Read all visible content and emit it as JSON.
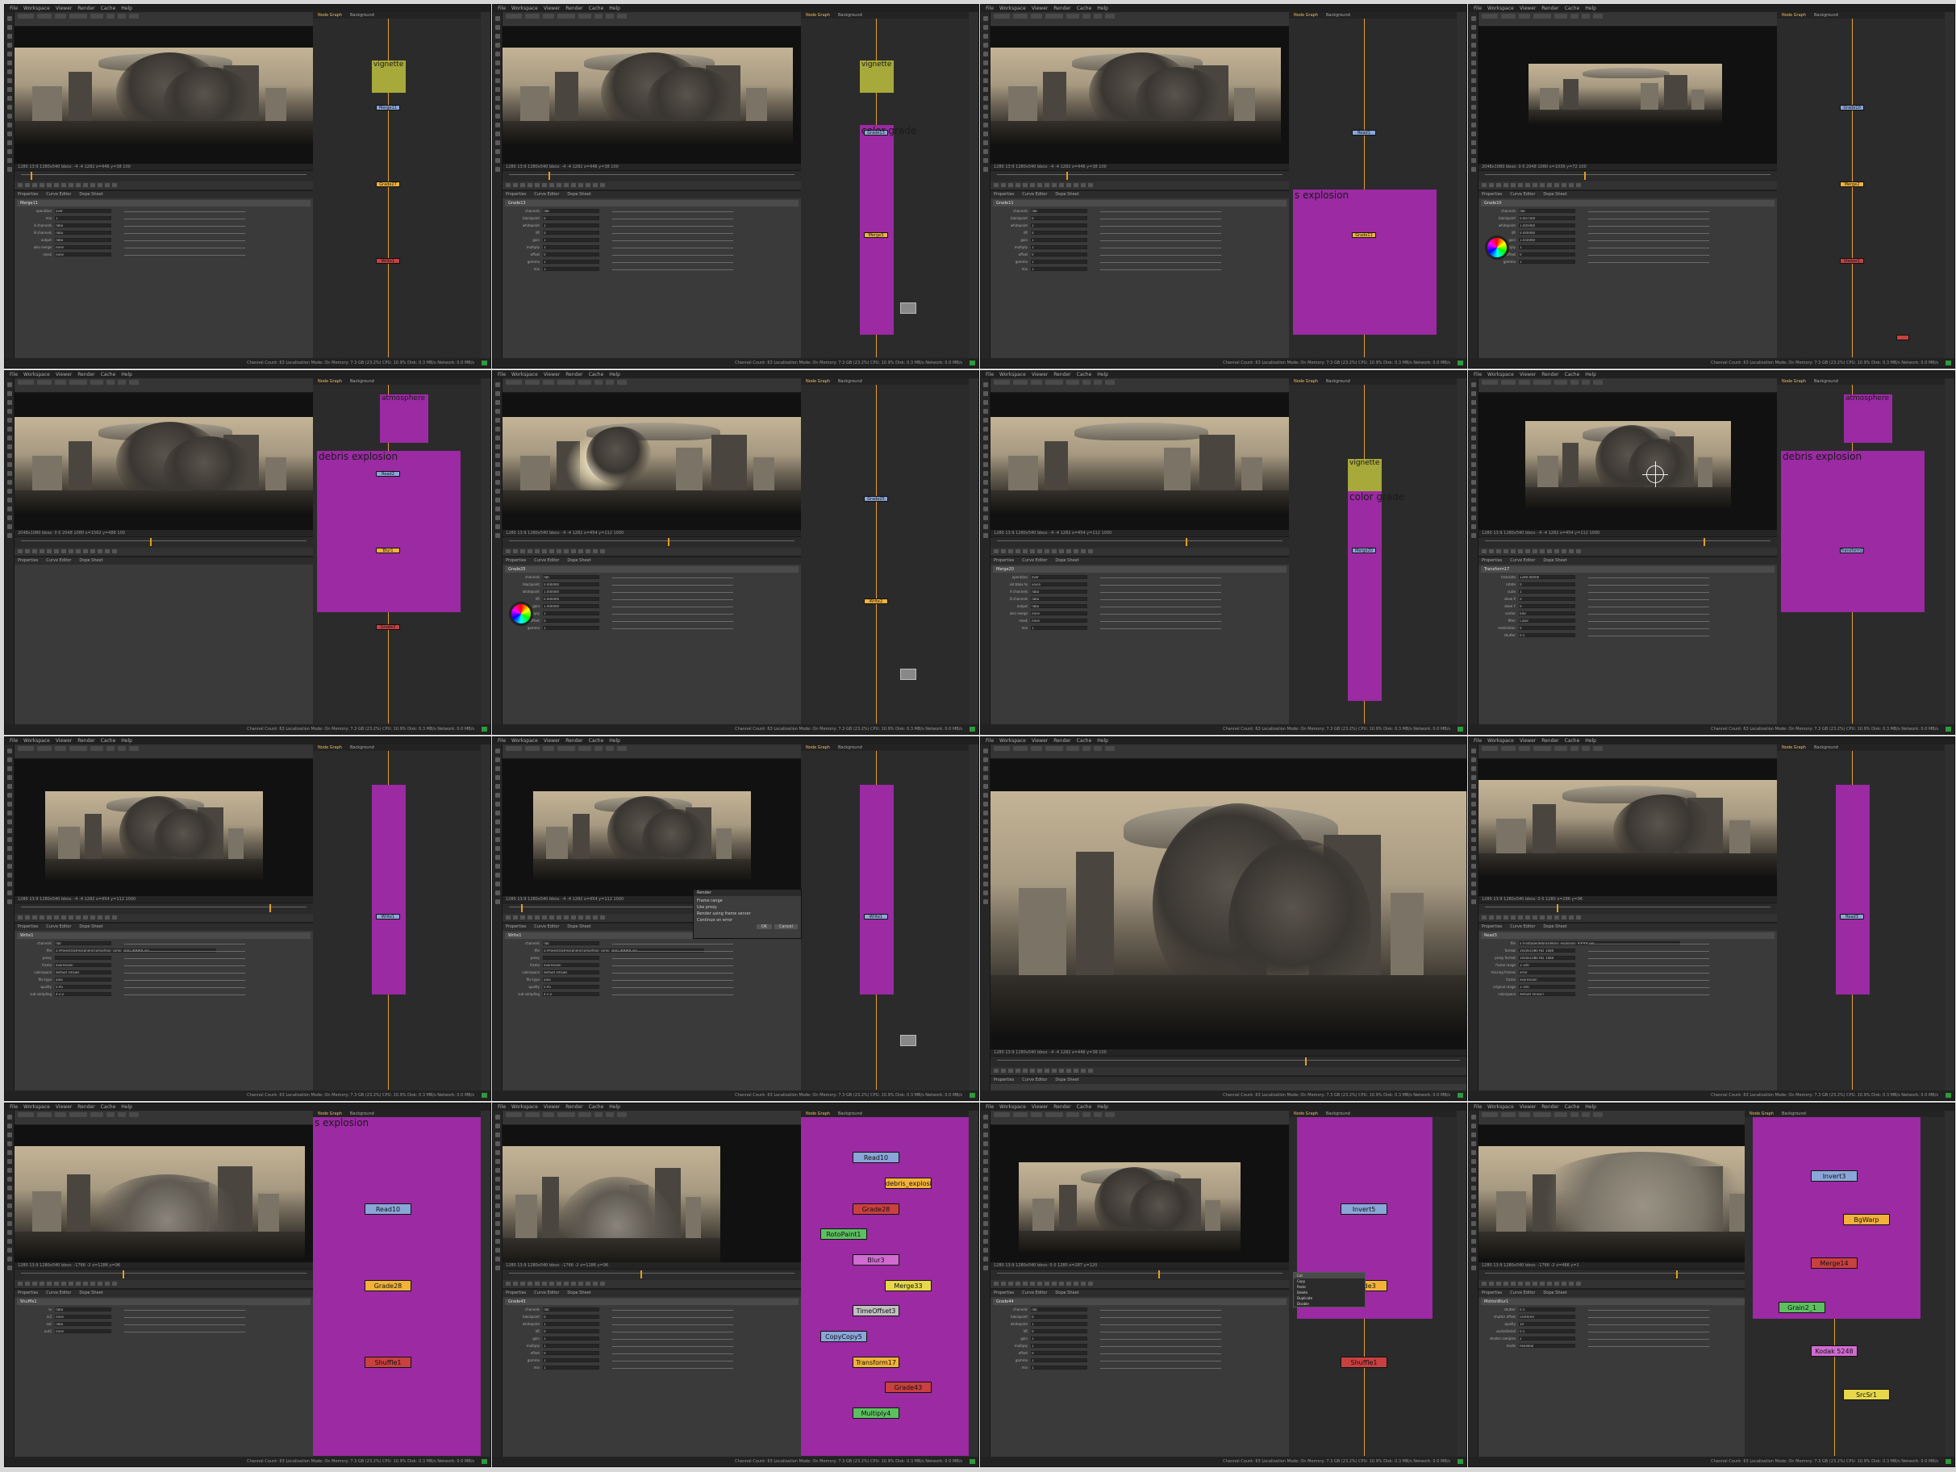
{
  "colors": {
    "backdrop_magenta": "#9b2aa3",
    "backdrop_olive": "#a7a93a",
    "backdrop_teal": "#2aa3a3",
    "node_orange": "#f2b23a",
    "node_yellow": "#e6d84a",
    "node_blue": "#8aa6d8",
    "node_red": "#c84040",
    "node_green": "#5cc060",
    "node_pink": "#d06bd0",
    "wire_orange": "#e0a040"
  },
  "menu": [
    "File",
    "Workspace",
    "Viewer",
    "Render",
    "Cache",
    "Help"
  ],
  "node_graph_tabs": [
    "Node Graph",
    "Background"
  ],
  "properties_tabs": [
    "Properties",
    "Curve Editor",
    "Dope Sheet"
  ],
  "status": "Channel Count: 63 Localization Mode: On Memory: 7.3 GB (23.2%) CPU: 10.9% Disk: 0.3 MB/s Network: 0.0 MB/s",
  "tiles": [
    {
      "id": "t1",
      "viewer_info": "1280 13:9 1280x540 bbox: -4 -4 1282 x=446 y=38 100",
      "props_node": "Merge11",
      "labels": [
        "operation",
        "mix",
        "A channels",
        "B channels",
        "output",
        "also merge",
        "mask"
      ],
      "values": [
        "over",
        "1",
        "rgba",
        "rgba",
        "rgba",
        "none",
        "none"
      ],
      "backdrops": [
        {
          "label": "vignette",
          "color": "#a7a93a"
        }
      ],
      "nodes": [
        "Merge11",
        "Grade27",
        "Write1"
      ]
    },
    {
      "id": "t2",
      "viewer_info": "1280 13:9 1280x540 bbox: -4 -4 1282 x=446 y=38 100",
      "props_node": "Grade13",
      "labels": [
        "channels",
        "blackpoint",
        "whitepoint",
        "lift",
        "gain",
        "multiply",
        "offset",
        "gamma",
        "mix"
      ],
      "values": [
        "rgb",
        "0",
        "1",
        "0",
        "1",
        "1",
        "0",
        "1",
        "1"
      ],
      "backdrops": [
        {
          "label": "vignette",
          "color": "#a7a93a"
        },
        {
          "label": "color grade",
          "color": "#9b2aa3"
        }
      ],
      "nodes": [
        "Grade13",
        "Merge3"
      ]
    },
    {
      "id": "t3",
      "viewer_info": "1280 13:9 1280x540 bbox: -4 -4 1282 x=446 y=38 100",
      "props_node": "Grade11",
      "labels": [
        "channels",
        "blackpoint",
        "whitepoint",
        "lift",
        "gain",
        "multiply",
        "offset",
        "gamma",
        "mix"
      ],
      "values": [
        "rgb",
        "0",
        "1",
        "0",
        "1",
        "1",
        "0",
        "1",
        "1"
      ],
      "backdrops": [
        {
          "label": "s explosion",
          "color": "#9b2aa3"
        }
      ],
      "nodes": [
        "Read1",
        "Grade11"
      ]
    },
    {
      "id": "t4",
      "viewer_info": "2048x1080 bbox: 0 0 2048 1080 x=1036 y=72 100",
      "props_node": "Grade10",
      "labels": [
        "channels",
        "blackpoint",
        "whitepoint",
        "lift",
        "gain",
        "multiply",
        "offset",
        "gamma"
      ],
      "values": [
        "rgb",
        "0.007500",
        "1.005000",
        "0.000000",
        "1.050000",
        "1",
        "0",
        "1"
      ],
      "backdrops": [],
      "nodes": [
        "Grade10",
        "Merge2",
        "Viewer1"
      ]
    },
    {
      "id": "t5",
      "viewer_info": "2048x1080 bbox: 0 0 2048 1080 x=1592 y=486 100",
      "props_node": "",
      "labels": [],
      "values": [],
      "backdrops": [
        {
          "label": "atmosphere",
          "color": "#9b2aa3"
        },
        {
          "label": "debris explosion",
          "color": "#9b2aa3"
        }
      ],
      "nodes": [
        "Read2",
        "Blur1",
        "Grade3"
      ]
    },
    {
      "id": "t6",
      "viewer_info": "1280 13:9 1280x540 bbox: -4 -4 1282 x=454 y=112 1000",
      "props_node": "Grade25",
      "labels": [
        "channels",
        "blackpoint",
        "whitepoint",
        "lift",
        "gain",
        "multiply",
        "offset",
        "gamma"
      ],
      "values": [
        "rgb",
        "0.000000",
        "1.000000",
        "0.000000",
        "1.000000",
        "1",
        "0",
        "1"
      ],
      "backdrops": [],
      "nodes": [
        "Grade25",
        "Write2"
      ]
    },
    {
      "id": "t7",
      "viewer_info": "1280 13:9 1280x540 bbox: -4 -4 1282 x=454 y=112 1000",
      "props_node": "Merge20",
      "labels": [
        "operation",
        "set bbox to",
        "A channels",
        "B channels",
        "output",
        "also merge",
        "mask",
        "mix"
      ],
      "values": [
        "over",
        "union",
        "rgba",
        "rgba",
        "rgba",
        "none",
        "none",
        "1"
      ],
      "backdrops": [
        {
          "label": "vignette",
          "color": "#a7a93a"
        },
        {
          "label": "color grade",
          "color": "#9b2aa3"
        }
      ],
      "nodes": [
        "Merge20"
      ]
    },
    {
      "id": "t8",
      "viewer_info": "1280 13:9 1280x540 bbox: -4 -4 1282 x=454 y=112 1000",
      "props_node": "Transform17",
      "labels": [
        "translate",
        "rotate",
        "scale",
        "skew X",
        "skew Y",
        "center",
        "filter",
        "motionblur",
        "shutter"
      ],
      "values": [
        "1280.00000",
        "0",
        "1",
        "0",
        "0",
        "640",
        "Cubic",
        "0",
        "0.5"
      ],
      "backdrops": [
        {
          "label": "atmosphere",
          "color": "#9b2aa3"
        },
        {
          "label": "debris explosion",
          "color": "#9b2aa3"
        }
      ],
      "nodes": [
        "Transform17"
      ]
    },
    {
      "id": "t9",
      "viewer_info": "1280 13:9 1280x540 bbox: -4 -4 1282 x=454 y=112 1000",
      "props_node": "Write1",
      "labels": [
        "channels",
        "file",
        "proxy",
        "frame",
        "colorspace",
        "file type",
        "quality",
        "sub-sampling"
      ],
      "values": [
        "rgb",
        "x:/Projects/atmosphere/comp/final_comp_v001.####.jpg",
        "",
        "expression",
        "default (sRGB)",
        "jpeg",
        "0.95",
        "4:2:2"
      ],
      "backdrops": [
        {
          "label": "",
          "color": "#9b2aa3"
        }
      ],
      "nodes": [
        "Write1"
      ]
    },
    {
      "id": "t10",
      "viewer_info": "1280 13:9 1280x540 bbox: -4 -4 1282 x=454 y=112 1000",
      "props_node": "Write1",
      "labels": [
        "channels",
        "file",
        "proxy",
        "frame",
        "colorspace",
        "file type",
        "quality",
        "sub-sampling"
      ],
      "values": [
        "rgb",
        "x:/Projects/atmosphere/comp/final_comp_v001.####.jpg",
        "",
        "expression",
        "default (sRGB)",
        "jpeg",
        "0.95",
        "4:2:2"
      ],
      "backdrops": [
        {
          "label": "",
          "color": "#9b2aa3"
        }
      ],
      "nodes": [
        "Write1"
      ],
      "dialog": {
        "title": "Render",
        "rows": [
          "Frame range",
          "Use proxy",
          "Render using frame server",
          "Continue on error"
        ],
        "buttons": [
          "OK",
          "Cancel"
        ]
      }
    },
    {
      "id": "t11",
      "viewer_info": "1280 13:9 1280x540 bbox: -4 -4 1282 x=446 y=38 100",
      "props_node": "",
      "labels": [],
      "values": [],
      "backdrops": [],
      "nodes": []
    },
    {
      "id": "t12",
      "viewer_info": "1280 13:9 1280x540 bbox: 0 0 1280 x=286 y=96",
      "props_node": "Read3",
      "labels": [
        "file",
        "format",
        "proxy format",
        "frame range",
        "missing frames",
        "frame",
        "original range",
        "colorspace"
      ],
      "values": [
        "x:/Footage/debris/debris_explosion_####.exr",
        "1920x1080 HD_1080",
        "1920x1080 HD_1080",
        "1-100",
        "error",
        "expression",
        "1-100",
        "default (linear)"
      ],
      "backdrops": [
        {
          "label": "",
          "color": "#9b2aa3"
        }
      ],
      "nodes": [
        "Read3"
      ]
    },
    {
      "id": "t13",
      "viewer_info": "1280 13:9 1280x540 bbox: -1766 -2 x=1286 y=96",
      "props_node": "Shuffle1",
      "labels": [
        "in",
        "in2",
        "out",
        "out2"
      ],
      "values": [
        "rgba",
        "none",
        "rgba",
        "none"
      ],
      "backdrops": [
        {
          "label": "s explosion",
          "color": "#9b2aa3"
        }
      ],
      "nodes": [
        "Read10",
        "Grade28",
        "Shuffle1"
      ]
    },
    {
      "id": "t14",
      "viewer_info": "1280 13:9 1280x540 bbox: -1766 -2 x=1286 y=96",
      "props_node": "Grade43",
      "labels": [
        "channels",
        "blackpoint",
        "whitepoint",
        "lift",
        "gain",
        "multiply",
        "offset",
        "gamma",
        "mix"
      ],
      "values": [
        "rgb",
        "0",
        "1",
        "0",
        "1",
        "1",
        "0",
        "1",
        "1"
      ],
      "backdrops": [
        {
          "label": "",
          "color": "#9b2aa3"
        }
      ],
      "nodes": [
        "Read10",
        "debris_explosion_0010.exr",
        "Grade28",
        "RotoPaint1",
        "Blur3",
        "Merge33",
        "TimeOffset3",
        "CopyCopy5",
        "Transform17",
        "Grade43",
        "Multiply4"
      ]
    },
    {
      "id": "t15",
      "viewer_info": "1280 13:9 1280x540 bbox: 0 0 1280 x=287 y=120",
      "props_node": "Grade44",
      "labels": [
        "channels",
        "blackpoint",
        "whitepoint",
        "lift",
        "gain",
        "multiply",
        "offset",
        "gamma",
        "mix"
      ],
      "values": [
        "rgb",
        "0",
        "1",
        "0",
        "1",
        "1",
        "0",
        "1",
        "1"
      ],
      "backdrops": [
        {
          "label": "",
          "color": "#9b2aa3"
        }
      ],
      "nodes": [
        "Invert5",
        "Grade3",
        "Shuffle1"
      ],
      "menu": [
        "Cut",
        "Copy",
        "Paste",
        "Delete",
        "Duplicate",
        "Disable"
      ]
    },
    {
      "id": "t16",
      "viewer_info": "1280 13:9 1280x540 bbox: -1766 -2 x=466 y=1",
      "props_node": "MotionBlur1",
      "labels": [
        "shutter",
        "shutter offset",
        "quality",
        "vectorDetail",
        "shutter samples",
        "mode"
      ],
      "values": [
        "0.5",
        "centered",
        "10",
        "0.5",
        "2",
        "Reglobal"
      ],
      "backdrops": [
        {
          "label": "",
          "color": "#9b2aa3"
        }
      ],
      "nodes": [
        "Invert3",
        "BgWarp",
        "Merge14",
        "Grain2_1",
        "Kodak 5248",
        "SrcSr1"
      ]
    }
  ]
}
